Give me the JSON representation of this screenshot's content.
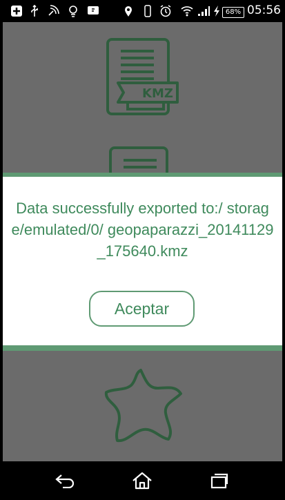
{
  "status_bar": {
    "battery": "68%",
    "time": "05:56",
    "icons": [
      "add-icon",
      "usb-icon",
      "satellite-icon",
      "lightbulb-icon",
      "notification-icon",
      "location-icon",
      "vibrate-icon",
      "alarm-icon",
      "wifi-icon",
      "signal-icon",
      "charging-icon"
    ]
  },
  "background": {
    "kmz_icon_label": "KMZ"
  },
  "dialog": {
    "message": "Data successfully exported to:/ storage/emulated/0/ geopaparazzi_20141129_175640.kmz",
    "button_label": "Aceptar"
  },
  "nav_bar": {
    "icons": [
      "back-icon",
      "home-icon",
      "recents-icon"
    ]
  },
  "colors": {
    "accent": "#5f9a73",
    "text": "#3f8a5c",
    "icon_green": "#2f5e3e",
    "dim_background": "#6b6b6b"
  }
}
